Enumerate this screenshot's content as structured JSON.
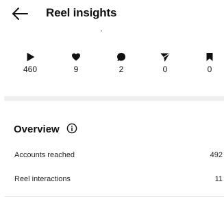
{
  "header": {
    "title": "Reel insights",
    "back_icon": "arrow-left-icon"
  },
  "metrics": [
    {
      "icon": "play-icon",
      "value": "460"
    },
    {
      "icon": "heart-icon",
      "value": "9"
    },
    {
      "icon": "comment-icon",
      "value": "2"
    },
    {
      "icon": "share-icon",
      "value": "0"
    },
    {
      "icon": "bookmark-icon",
      "value": "0"
    }
  ],
  "overview": {
    "title": "Overview",
    "info_icon": "info-icon",
    "rows": [
      {
        "label": "Accounts reached",
        "value": "492"
      },
      {
        "label": "Reel interactions",
        "value": "11"
      }
    ]
  },
  "colors": {
    "text": "#111111",
    "divider": "#efefef"
  }
}
